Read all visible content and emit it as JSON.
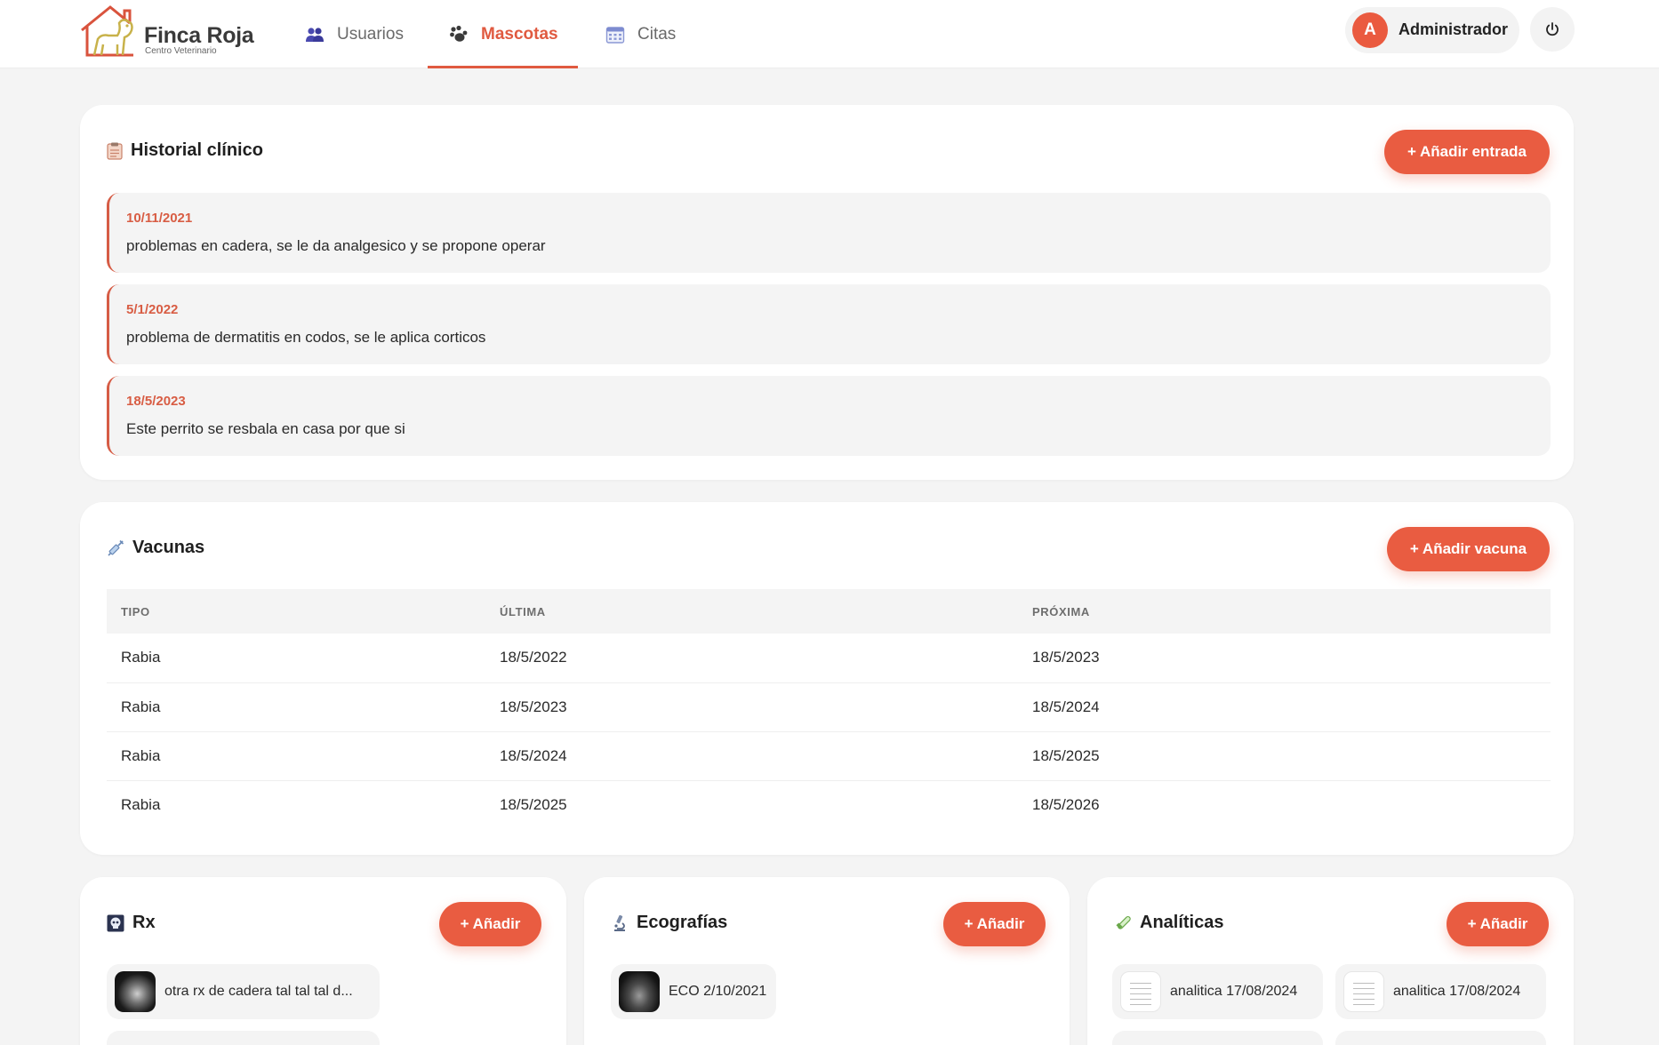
{
  "brand": {
    "title": "Finca Roja",
    "subtitle": "Centro Veterinario"
  },
  "nav": [
    {
      "label": "Usuarios",
      "icon": "users-icon",
      "active": false
    },
    {
      "label": "Mascotas",
      "icon": "paw-icon",
      "active": true
    },
    {
      "label": "Citas",
      "icon": "calendar-icon",
      "active": false
    }
  ],
  "user": {
    "initial": "A",
    "name": "Administrador",
    "logout_icon": "power-icon"
  },
  "colors": {
    "accent": "#e95c41",
    "accent_text": "#d85d44",
    "background": "#f4f4f4"
  },
  "historial": {
    "title": "Historial clínico",
    "icon": "clipboard-icon",
    "add_label": "+ Añadir entrada",
    "entries": [
      {
        "date": "10/11/2021",
        "text": "problemas en cadera, se le da analgesico y se propone operar"
      },
      {
        "date": "5/1/2022",
        "text": "problema de dermatitis en codos, se le aplica corticos"
      },
      {
        "date": "18/5/2023",
        "text": "Este perrito se resbala en casa por que si"
      }
    ]
  },
  "vacunas": {
    "title": "Vacunas",
    "icon": "syringe-icon",
    "add_label": "+ Añadir vacuna",
    "columns": [
      "TIPO",
      "ÚLTIMA",
      "PRÓXIMA"
    ],
    "rows": [
      [
        "Rabia",
        "18/5/2022",
        "18/5/2023"
      ],
      [
        "Rabia",
        "18/5/2023",
        "18/5/2024"
      ],
      [
        "Rabia",
        "18/5/2024",
        "18/5/2025"
      ],
      [
        "Rabia",
        "18/5/2025",
        "18/5/2026"
      ]
    ]
  },
  "rx": {
    "title": "Rx",
    "icon": "skull-icon",
    "add_label": "+ Añadir",
    "files": [
      {
        "label": "otra rx de cadera tal tal tal d..."
      }
    ]
  },
  "ecografias": {
    "title": "Ecografías",
    "icon": "microscope-icon",
    "add_label": "+ Añadir",
    "files": [
      {
        "label": "ECO 2/10/2021"
      }
    ]
  },
  "analiticas": {
    "title": "Analíticas",
    "icon": "test-tube-icon",
    "add_label": "+ Añadir",
    "files": [
      {
        "label": "analitica 17/08/2024"
      },
      {
        "label": "analitica 17/08/2024"
      }
    ]
  }
}
